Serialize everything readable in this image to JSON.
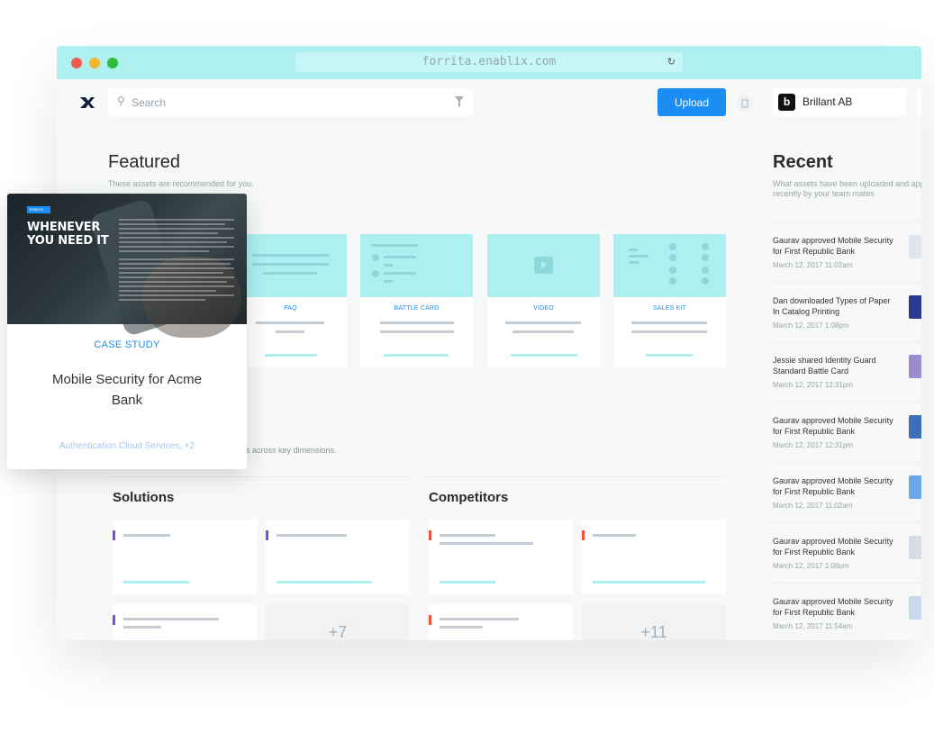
{
  "browser": {
    "url": "forrita.enablix.com"
  },
  "header": {
    "search_placeholder": "Search",
    "upload_label": "Upload",
    "company_initial": "b",
    "company_name": "Brillant AB"
  },
  "featured": {
    "title": "Featured",
    "subtitle": "These assets are recommended for you.",
    "cards": [
      {
        "label": "FAQ"
      },
      {
        "label": "BATTLE CARD"
      },
      {
        "label": "VIDEO"
      },
      {
        "label": "SALES KIT"
      }
    ]
  },
  "dimensions_text": "s across key dimensions.",
  "solutions": {
    "title": "Solutions",
    "more_label": "+7",
    "accent_color": "#7b4ee0"
  },
  "competitors": {
    "title": "Competitors",
    "more_label": "+11",
    "accent_color": "#f0533a"
  },
  "recent": {
    "title": "Recent",
    "subtitle": "What assets have been uploaded and app recently by your team mates",
    "items": [
      {
        "text": "Gaurav approved Mobile Security for First Republic Bank",
        "time": "March 12, 2017 11:02am"
      },
      {
        "text": "Dan downloaded Types of Paper In Catalog Printing",
        "time": "March 12, 2017 1:08pm"
      },
      {
        "text": "Jessie shared Identity Guard Standard Battle Card",
        "time": "March 12, 2017 12:31pm"
      },
      {
        "text": "Gaurav approved Mobile Security for First Republic Bank",
        "time": "March 12, 2017 12:31pm"
      },
      {
        "text": "Gaurav approved Mobile Security for First Republic Bank",
        "time": "March 12, 2017 11:02am"
      },
      {
        "text": "Gaurav approved Mobile Security for First Republic Bank",
        "time": "March 12, 2017 1:08pm"
      },
      {
        "text": "Gaurav approved Mobile Security for First Republic Bank",
        "time": "March 12, 2017 11:54am"
      }
    ]
  },
  "case_study": {
    "image_tag": "EDB015",
    "headline": "WHENEVER YOU NEED IT",
    "type": "CASE STUDY",
    "title": "Mobile Security for Acme Bank",
    "tags": "Authentication Cloud Services, +2"
  },
  "colors": {
    "accent_blue": "#1a8ef2",
    "titlebar_cyan": "#aef0f0"
  }
}
